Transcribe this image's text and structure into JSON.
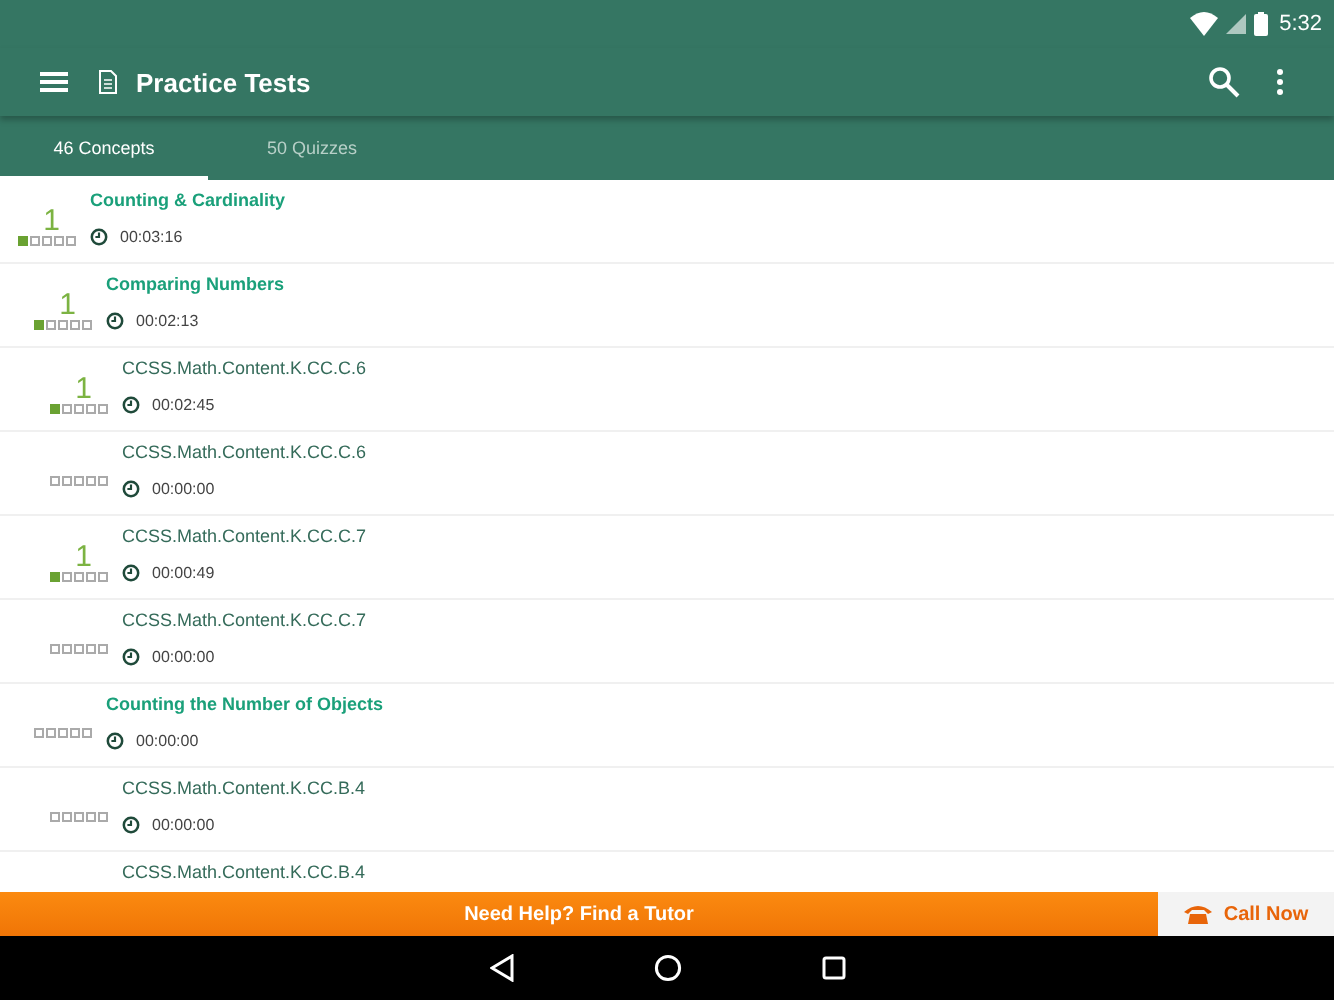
{
  "status_bar": {
    "time": "5:32"
  },
  "toolbar": {
    "title": "Practice Tests"
  },
  "tabs": [
    {
      "label": "46 Concepts",
      "selected": true
    },
    {
      "label": "50 Quizzes",
      "selected": false
    }
  ],
  "concepts": [
    {
      "kind": "topic",
      "title": "Counting & Cardinality",
      "score": "1",
      "stars": 1,
      "time": "00:03:16",
      "children": [
        {
          "kind": "topic",
          "title": "Comparing Numbers",
          "score": "1",
          "stars": 1,
          "time": "00:02:13",
          "children": [
            {
              "kind": "standard",
              "title": "CCSS.Math.Content.K.CC.C.6",
              "score": "1",
              "stars": 1,
              "time": "00:02:45"
            },
            {
              "kind": "standard",
              "title": "CCSS.Math.Content.K.CC.C.6",
              "stars": 0,
              "time": "00:00:00"
            },
            {
              "kind": "standard",
              "title": "CCSS.Math.Content.K.CC.C.7",
              "score": "1",
              "stars": 1,
              "time": "00:00:49"
            },
            {
              "kind": "standard",
              "title": "CCSS.Math.Content.K.CC.C.7",
              "stars": 0,
              "time": "00:00:00"
            }
          ]
        },
        {
          "kind": "topic",
          "title": "Counting the Number of Objects",
          "stars": 0,
          "time": "00:00:00",
          "children": [
            {
              "kind": "standard",
              "title": "CCSS.Math.Content.K.CC.B.4",
              "stars": 0,
              "time": "00:00:00"
            },
            {
              "kind": "standard",
              "title": "CCSS.Math.Content.K.CC.B.4"
            }
          ]
        }
      ]
    }
  ],
  "banner": {
    "text": "Need Help? Find a Tutor",
    "call": "Call Now"
  }
}
